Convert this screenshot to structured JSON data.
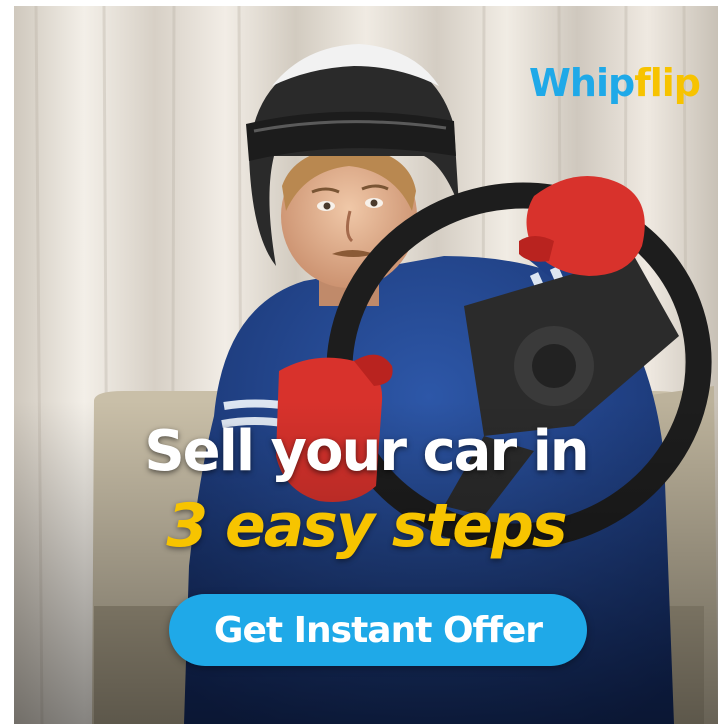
{
  "brand": {
    "logo_part1": "Whip",
    "logo_part2": "flip",
    "color_primary": "#1fa9e8",
    "color_accent": "#f7c300"
  },
  "headline": "Sell your car in",
  "subheadline": "3 easy steps",
  "cta_label": "Get Instant Offer"
}
